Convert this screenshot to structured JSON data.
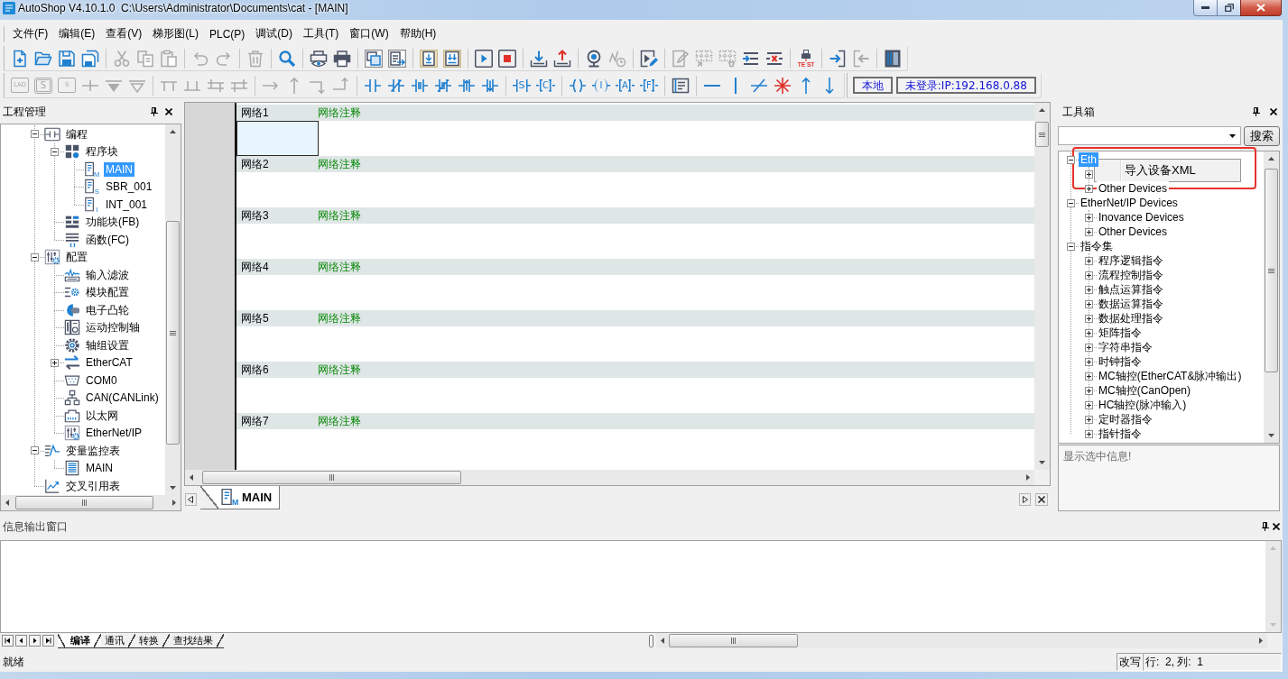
{
  "window": {
    "title": "AutoShop V4.10.1.0  C:\\Users\\Administrator\\Documents\\cat - [MAIN]"
  },
  "menu": [
    "文件(F)",
    "编辑(E)",
    "查看(V)",
    "梯形图(L)",
    "PLC(P)",
    "调试(D)",
    "工具(T)",
    "窗口(W)",
    "帮助(H)"
  ],
  "toolbars": [
    [
      {
        "kind": "new",
        "disabled": false
      },
      {
        "kind": "open",
        "disabled": false
      },
      {
        "kind": "save",
        "disabled": false
      },
      {
        "kind": "saveall",
        "disabled": false
      },
      {
        "kind": "separator"
      },
      {
        "kind": "cut",
        "disabled": true
      },
      {
        "kind": "copy",
        "disabled": true
      },
      {
        "kind": "paste",
        "disabled": true
      },
      {
        "kind": "separator"
      },
      {
        "kind": "undo",
        "disabled": true
      },
      {
        "kind": "redo",
        "disabled": true
      },
      {
        "kind": "separator"
      },
      {
        "kind": "delete",
        "disabled": true
      },
      {
        "kind": "separator"
      },
      {
        "kind": "find",
        "disabled": false
      },
      {
        "kind": "separator"
      },
      {
        "kind": "preview",
        "disabled": false
      },
      {
        "kind": "print",
        "disabled": false
      },
      {
        "kind": "separator"
      },
      {
        "kind": "windows",
        "disabled": false
      },
      {
        "kind": "windowlist",
        "disabled": false
      },
      {
        "kind": "separator"
      },
      {
        "kind": "compile",
        "disabled": false
      },
      {
        "kind": "compileall",
        "disabled": false
      },
      {
        "kind": "separator"
      },
      {
        "kind": "run",
        "disabled": false
      },
      {
        "kind": "stop",
        "disabled": false
      },
      {
        "kind": "separator"
      },
      {
        "kind": "download",
        "disabled": false
      },
      {
        "kind": "upload",
        "disabled": false
      },
      {
        "kind": "separator"
      },
      {
        "kind": "monitor",
        "disabled": false
      },
      {
        "kind": "trend",
        "disabled": true
      },
      {
        "kind": "separator"
      },
      {
        "kind": "debug",
        "disabled": false
      },
      {
        "kind": "separator"
      },
      {
        "kind": "edit",
        "disabled": true
      },
      {
        "kind": "gridadd",
        "disabled": true
      },
      {
        "kind": "griddelete",
        "disabled": true
      },
      {
        "kind": "insertrow",
        "disabled": false
      },
      {
        "kind": "deleterow",
        "disabled": false
      },
      {
        "kind": "separator"
      },
      {
        "kind": "usbtest",
        "label": "TE ST",
        "disabled": false
      },
      {
        "kind": "separator"
      },
      {
        "kind": "login",
        "disabled": false
      },
      {
        "kind": "logout",
        "disabled": true
      },
      {
        "kind": "separator"
      },
      {
        "kind": "panel",
        "disabled": false
      }
    ],
    [
      {
        "kind": "lad",
        "label": "LAD",
        "disabled": true
      },
      {
        "kind": "sdouble",
        "label": "S",
        "disabled": true
      },
      {
        "kind": "sbox",
        "label": "S",
        "disabled": true
      },
      {
        "kind": "crossline",
        "disabled": true
      },
      {
        "kind": "arrowfill",
        "disabled": true
      },
      {
        "kind": "arrowoutline",
        "disabled": true
      },
      {
        "kind": "separator"
      },
      {
        "kind": "branchdown",
        "disabled": true
      },
      {
        "kind": "branchup",
        "disabled": true
      },
      {
        "kind": "branchsplit",
        "disabled": true
      },
      {
        "kind": "branchjoin",
        "disabled": true
      },
      {
        "kind": "separator"
      },
      {
        "kind": "lineright",
        "disabled": true
      },
      {
        "kind": "lineup",
        "disabled": true
      },
      {
        "kind": "cornerdown",
        "disabled": true
      },
      {
        "kind": "cornerup",
        "disabled": true
      },
      {
        "kind": "separator"
      },
      {
        "kind": "contactno",
        "disabled": false
      },
      {
        "kind": "contactnc",
        "disabled": false
      },
      {
        "kind": "contactorno",
        "disabled": false
      },
      {
        "kind": "contactornc",
        "disabled": false
      },
      {
        "kind": "rising",
        "disabled": false
      },
      {
        "kind": "falling",
        "disabled": false
      },
      {
        "kind": "separator"
      },
      {
        "kind": "setbars",
        "label": "S",
        "disabled": false
      },
      {
        "kind": "bracket",
        "label": "C",
        "disabled": false
      },
      {
        "kind": "separator"
      },
      {
        "kind": "coil",
        "disabled": false
      },
      {
        "kind": "paren",
        "label": "I",
        "disabled": false
      },
      {
        "kind": "bracket",
        "label": "A",
        "disabled": false
      },
      {
        "kind": "bracket",
        "label": "F",
        "disabled": false
      },
      {
        "kind": "separator"
      },
      {
        "kind": "list",
        "disabled": false
      },
      {
        "kind": "separator"
      },
      {
        "kind": "hline",
        "disabled": false
      },
      {
        "kind": "vline",
        "disabled": false
      },
      {
        "kind": "diagonal",
        "disabled": false
      },
      {
        "kind": "asterisk",
        "disabled": false
      },
      {
        "kind": "arrowup",
        "disabled": false
      },
      {
        "kind": "arrowdown",
        "disabled": false
      }
    ],
    [
      {
        "kind": "status",
        "label": "本地",
        "disabled": false
      },
      {
        "kind": "status",
        "label": "未登录:IP:192.168.0.88",
        "disabled": false
      }
    ]
  ],
  "project_panel": {
    "title": "工程管理",
    "tree": [
      {
        "label": "编程",
        "kind": "contact",
        "expanded": true,
        "selected": false,
        "children": [
          {
            "label": "程序块",
            "kind": "blocks",
            "expanded": true,
            "selected": false,
            "children": [
              {
                "label": "MAIN",
                "kind": "doc",
                "glyph": "M",
                "selected": true
              },
              {
                "label": "SBR_001",
                "kind": "doc",
                "glyph": "S",
                "selected": false
              },
              {
                "label": "INT_001",
                "kind": "doc",
                "glyph": "I",
                "selected": false
              }
            ]
          },
          {
            "label": "功能块(FB)",
            "kind": "fb",
            "selected": false
          },
          {
            "label": "函数(FC)",
            "kind": "fc",
            "selected": false
          }
        ]
      },
      {
        "label": "配置",
        "kind": "config",
        "expanded": true,
        "selected": false,
        "children": [
          {
            "label": "输入滤波",
            "kind": "filter",
            "selected": false
          },
          {
            "label": "模块配置",
            "kind": "module",
            "selected": false
          },
          {
            "label": "电子凸轮",
            "kind": "cam",
            "selected": false
          },
          {
            "label": "运动控制轴",
            "kind": "axis",
            "selected": false
          },
          {
            "label": "轴组设置",
            "kind": "gear",
            "selected": false
          },
          {
            "label": "EtherCAT",
            "kind": "exchange",
            "expanded": false,
            "selected": false
          },
          {
            "label": "COM0",
            "kind": "serial",
            "selected": false
          },
          {
            "label": "CAN(CANLink)",
            "kind": "can",
            "selected": false
          },
          {
            "label": "以太网",
            "kind": "ethernet",
            "selected": false
          },
          {
            "label": "EtherNet/IP",
            "kind": "config",
            "selected": false
          }
        ]
      },
      {
        "label": "变量监控表",
        "kind": "monitor",
        "expanded": true,
        "selected": false,
        "children": [
          {
            "label": "MAIN",
            "kind": "table",
            "selected": false
          }
        ]
      },
      {
        "label": "交叉引用表",
        "kind": "crossref",
        "selected": false
      }
    ]
  },
  "editor": {
    "networks": [
      {
        "label": "网络1",
        "comment": "网络注释",
        "selected": true
      },
      {
        "label": "网络2",
        "comment": "网络注释",
        "selected": false
      },
      {
        "label": "网络3",
        "comment": "网络注释",
        "selected": false
      },
      {
        "label": "网络4",
        "comment": "网络注释",
        "selected": false
      },
      {
        "label": "网络5",
        "comment": "网络注释",
        "selected": false
      },
      {
        "label": "网络6",
        "comment": "网络注释",
        "selected": false
      },
      {
        "label": "网络7",
        "comment": "网络注释",
        "selected": false
      }
    ],
    "tabs": [
      {
        "label": "MAIN",
        "glyph": "M",
        "selected": true
      }
    ]
  },
  "toolbox": {
    "title": "工具箱",
    "search_button": "搜索",
    "tree": [
      {
        "label": "Eth",
        "expanded": true,
        "selected": true,
        "children": [
          {
            "expanded": false
          },
          {
            "label": "Other Devices",
            "expanded": false,
            "selected": false
          }
        ]
      },
      {
        "label": "EtherNet/IP Devices",
        "expanded": true,
        "selected": false,
        "children": [
          {
            "label": "Inovance Devices",
            "expanded": false,
            "selected": false
          },
          {
            "label": "Other Devices",
            "expanded": false,
            "selected": false
          }
        ]
      },
      {
        "label": "指令集",
        "expanded": true,
        "selected": false,
        "children": [
          {
            "label": "程序逻辑指令",
            "expanded": false,
            "selected": false
          },
          {
            "label": "流程控制指令",
            "expanded": false,
            "selected": false
          },
          {
            "label": "触点运算指令",
            "expanded": false,
            "selected": false
          },
          {
            "label": "数据运算指令",
            "expanded": false,
            "selected": false
          },
          {
            "label": "数据处理指令",
            "expanded": false,
            "selected": false
          },
          {
            "label": "矩阵指令",
            "expanded": false,
            "selected": false
          },
          {
            "label": "字符串指令",
            "expanded": false,
            "selected": false
          },
          {
            "label": "时钟指令",
            "expanded": false,
            "selected": false
          },
          {
            "label": "MC轴控(EtherCAT&脉冲输出)",
            "expanded": false,
            "selected": false
          },
          {
            "label": "MC轴控(CanOpen)",
            "expanded": false,
            "selected": false
          },
          {
            "label": "HC轴控(脉冲输入)",
            "expanded": false,
            "selected": false
          },
          {
            "label": "定时器指令",
            "expanded": false,
            "selected": false
          },
          {
            "label": "指针指令",
            "expanded": false,
            "selected": false
          }
        ]
      }
    ],
    "context_menu": [
      "导入设备XML"
    ],
    "info": "显示选中信息!"
  },
  "output_panel": {
    "title": "信息输出窗口",
    "tabs": [
      {
        "label": "编译",
        "selected": true
      },
      {
        "label": "通讯",
        "selected": false
      },
      {
        "label": "转换",
        "selected": false
      },
      {
        "label": "查找结果",
        "selected": false
      }
    ]
  },
  "status_bar": {
    "message": "就绪",
    "mode": "改写",
    "position": "行:  2, 列:  1"
  }
}
